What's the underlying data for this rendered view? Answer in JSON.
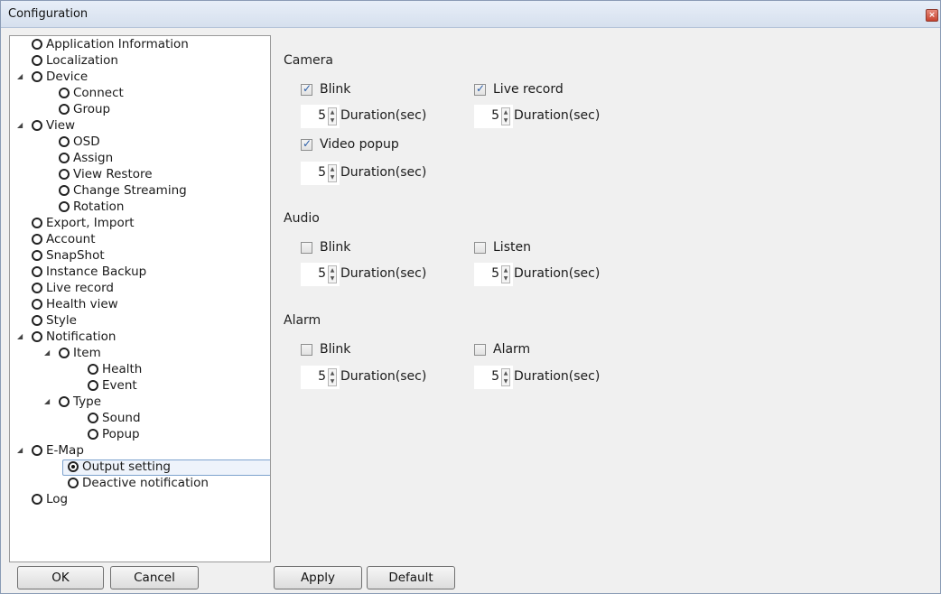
{
  "window": {
    "title": "Configuration",
    "close_icon": "close-icon"
  },
  "tree": [
    {
      "label": "Application Information"
    },
    {
      "label": "Localization"
    },
    {
      "label": "Device"
    },
    {
      "label": "Connect"
    },
    {
      "label": "Group"
    },
    {
      "label": "View"
    },
    {
      "label": "OSD"
    },
    {
      "label": "Assign"
    },
    {
      "label": "View Restore"
    },
    {
      "label": "Change Streaming"
    },
    {
      "label": "Rotation"
    },
    {
      "label": "Export, Import"
    },
    {
      "label": "Account"
    },
    {
      "label": "SnapShot"
    },
    {
      "label": "Instance Backup"
    },
    {
      "label": "Live record"
    },
    {
      "label": "Health view"
    },
    {
      "label": "Style"
    },
    {
      "label": "Notification"
    },
    {
      "label": "Item"
    },
    {
      "label": "Health"
    },
    {
      "label": "Event"
    },
    {
      "label": "Type"
    },
    {
      "label": "Sound"
    },
    {
      "label": "Popup"
    },
    {
      "label": "E-Map"
    },
    {
      "label": "Output setting",
      "selected": true
    },
    {
      "label": "Deactive notification"
    },
    {
      "label": "Log"
    }
  ],
  "buttons": {
    "ok": "OK",
    "cancel": "Cancel",
    "apply": "Apply",
    "default": "Default"
  },
  "camera": {
    "title": "Camera",
    "blink": {
      "label": "Blink",
      "checked": true,
      "value": "5",
      "unit": "Duration(sec)"
    },
    "live_record": {
      "label": "Live record",
      "checked": true,
      "value": "5",
      "unit": "Duration(sec)"
    },
    "video_popup": {
      "label": "Video popup",
      "checked": true,
      "value": "5",
      "unit": "Duration(sec)"
    }
  },
  "audio": {
    "title": "Audio",
    "blink": {
      "label": "Blink",
      "checked": false,
      "value": "5",
      "unit": "Duration(sec)"
    },
    "listen": {
      "label": "Listen",
      "checked": false,
      "value": "5",
      "unit": "Duration(sec)"
    }
  },
  "alarm": {
    "title": "Alarm",
    "blink": {
      "label": "Blink",
      "checked": false,
      "value": "5",
      "unit": "Duration(sec)"
    },
    "alarm": {
      "label": "Alarm",
      "checked": false,
      "value": "5",
      "unit": "Duration(sec)"
    }
  }
}
